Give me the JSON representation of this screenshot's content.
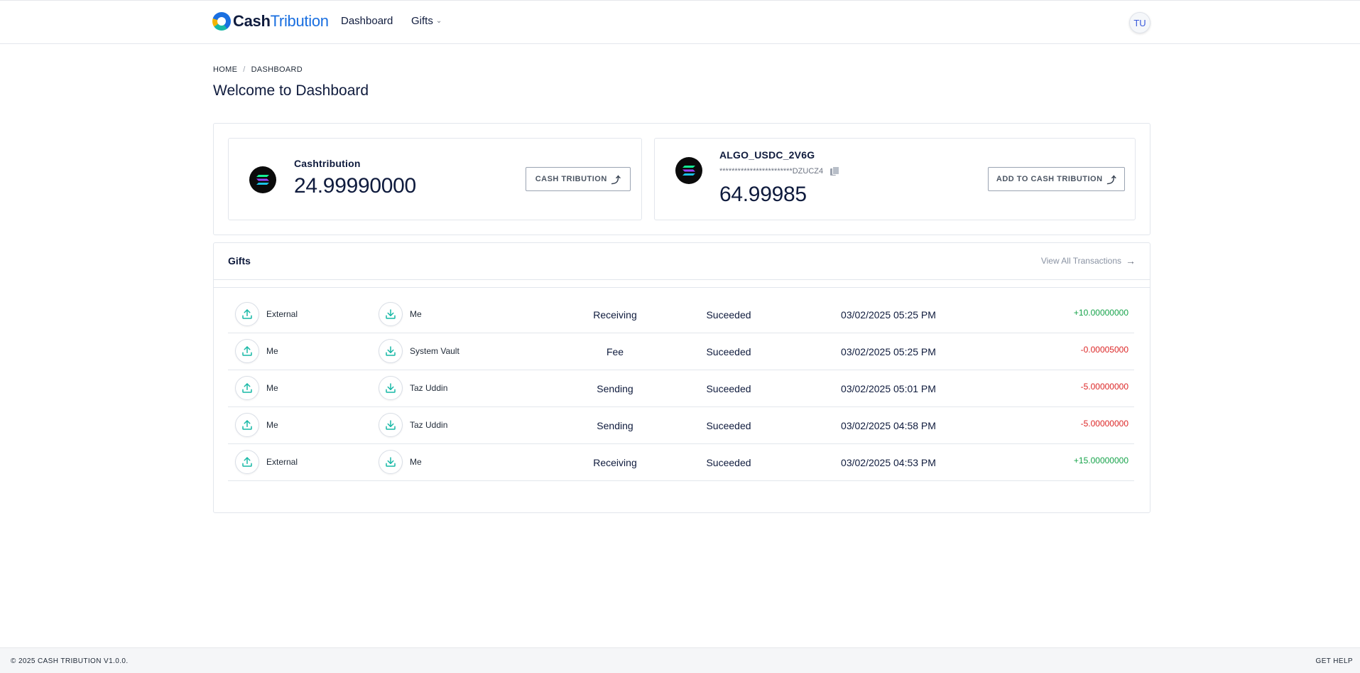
{
  "header": {
    "logo_bold": "Cash",
    "logo_light": "Tribution",
    "nav": {
      "dashboard": "Dashboard",
      "gifts": "Gifts"
    },
    "avatar_initials": "TU"
  },
  "breadcrumb": {
    "home": "HOME",
    "separator": "/",
    "current": "DASHBOARD"
  },
  "page_title": "Welcome to Dashboard",
  "wallets": [
    {
      "name": "Cashtribution",
      "amount": "24.99990000",
      "button_label": "CASH TRIBUTION",
      "icon": "solana-coin-icon"
    },
    {
      "name": "ALGO_USDC_2V6G",
      "address": "************************DZUCZ4",
      "amount": "64.99985",
      "button_label": "ADD TO CASH TRIBUTION",
      "icon": "solana-coin-icon"
    }
  ],
  "gifts": {
    "title": "Gifts",
    "view_all": "View All Transactions",
    "rows": [
      {
        "from": "External",
        "to": "Me",
        "type": "Receiving",
        "status": "Suceeded",
        "date": "03/02/2025 05:25 PM",
        "amount": "+10.00000000",
        "sign": "pos"
      },
      {
        "from": "Me",
        "to": "System Vault",
        "type": "Fee",
        "status": "Suceeded",
        "date": "03/02/2025 05:25 PM",
        "amount": "-0.00005000",
        "sign": "neg"
      },
      {
        "from": "Me",
        "to": "Taz Uddin",
        "type": "Sending",
        "status": "Suceeded",
        "date": "03/02/2025 05:01 PM",
        "amount": "-5.00000000",
        "sign": "neg"
      },
      {
        "from": "Me",
        "to": "Taz Uddin",
        "type": "Sending",
        "status": "Suceeded",
        "date": "03/02/2025 04:58 PM",
        "amount": "-5.00000000",
        "sign": "neg"
      },
      {
        "from": "External",
        "to": "Me",
        "type": "Receiving",
        "status": "Suceeded",
        "date": "03/02/2025 04:53 PM",
        "amount": "+15.00000000",
        "sign": "pos"
      }
    ]
  },
  "footer": {
    "copyright": "© 2025 CASH TRIBUTION V1.0.0.",
    "help": "GET HELP"
  },
  "colors": {
    "accent": "#1a6fe0",
    "icon_teal": "#17b8a6",
    "positive": "#16a34a",
    "negative": "#dc2626"
  }
}
